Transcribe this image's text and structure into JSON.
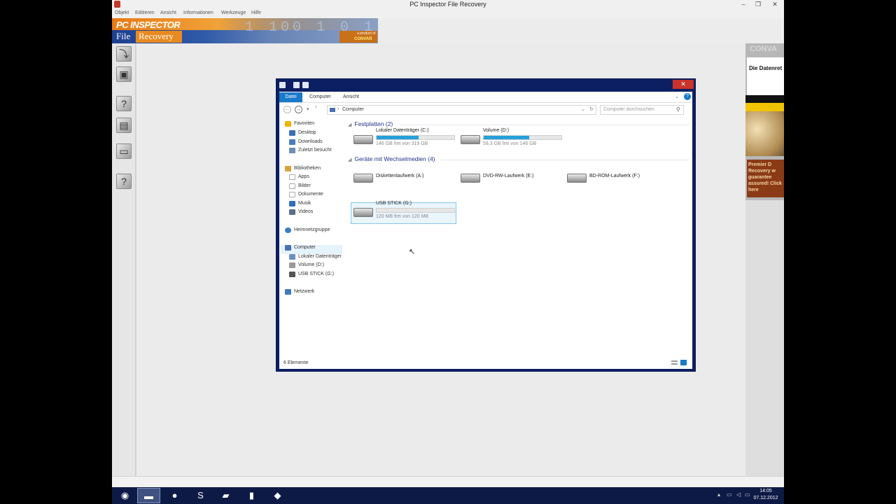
{
  "app": {
    "title": "PC Inspector File Recovery",
    "menu": [
      "Objekt",
      "Editieren",
      "Ansicht",
      "Informationen",
      "Werkzeuge",
      "Hilfe"
    ]
  },
  "banner": {
    "brand": "PC INSPECTOR",
    "product_a": "File",
    "product_b": "Recovery",
    "digits": "1 100 1 0 1",
    "badge_top": "a product of",
    "badge_bottom": "CONVAR"
  },
  "ad": {
    "brand": "CONVA",
    "headline": "Die Datenret",
    "body": "Premier D Recovery w guarantee assured! Click here"
  },
  "explorer": {
    "ribbon": {
      "file": "Datei",
      "tabs": [
        "Computer",
        "Ansicht"
      ]
    },
    "address": "Computer",
    "search_placeholder": "Computer durchsuchen",
    "nav": {
      "favoriten": "Favoriten",
      "desktop": "Desktop",
      "downloads": "Downloads",
      "zuletzt": "Zuletzt besucht",
      "bibliotheken": "Bibliotheken",
      "apps": "Apps",
      "bilder": "Bilder",
      "dokumente": "Dokumente",
      "musik": "Musik",
      "videos": "Videos",
      "heimnetz": "Heimnetzgruppe",
      "computer": "Computer",
      "lokal": "Lokaler Datenträger",
      "volume": "Volume (D:)",
      "usb": "USB STICK (G:)",
      "netzwerk": "Netzwerk"
    },
    "groups": {
      "festplatten": "Festplatten (2)",
      "wechsel": "Geräte mit Wechselmedien (4)"
    },
    "drives": {
      "c": {
        "name": "Lokaler Datenträger (C:)",
        "free": "146 GB frei von 319 GB",
        "used_fraction": 0.54
      },
      "d": {
        "name": "Volume (D:)",
        "free": "59,3 GB frei von 146 GB",
        "used_fraction": 0.59
      },
      "a": {
        "name": "Diskettenlaufwerk (A:)"
      },
      "e": {
        "name": "DVD-RW-Laufwerk (E:)"
      },
      "f": {
        "name": "BD-ROM-Laufwerk (F:)"
      },
      "g": {
        "name": "USB STICK (G:)",
        "free": "120 MB frei von 120 MB",
        "used_fraction": 0.0
      }
    },
    "status": "6 Elemente"
  },
  "taskbar": {
    "time": "14:05",
    "date": "07.12.2012"
  },
  "colors": {
    "accent": "#1979ca",
    "window_frame": "#0c1f63",
    "bar_fill": "#26a0da"
  }
}
